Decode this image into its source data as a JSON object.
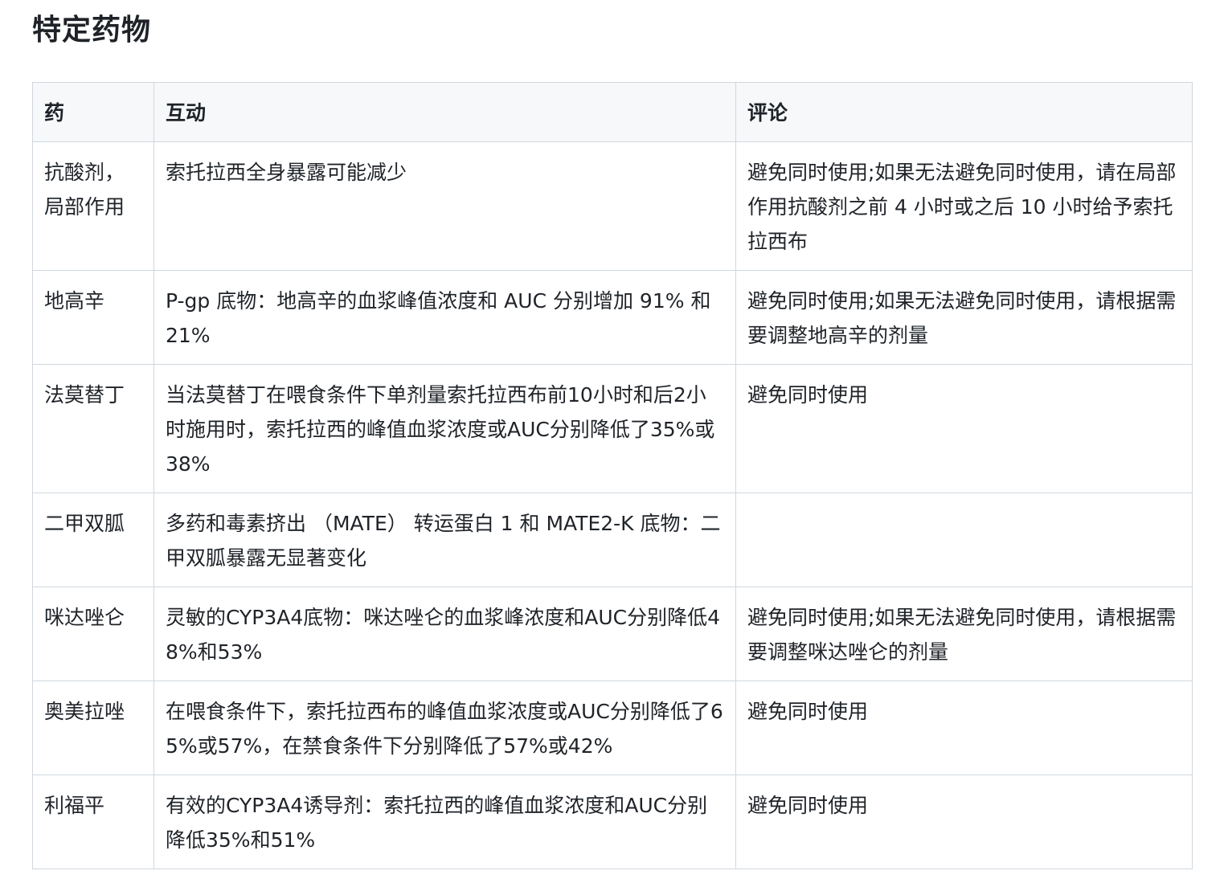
{
  "page_title": "特定药物",
  "table": {
    "headers": [
      "药",
      "互动",
      "评论"
    ],
    "rows": [
      [
        "抗酸剂，局部作用",
        "索托拉西全身暴露可能减少",
        "避免同时使用;如果无法避免同时使用，请在局部作用抗酸剂之前 4 小时或之后 10 小时给予索托拉西布"
      ],
      [
        "地高辛",
        "P-gp 底物：地高辛的血浆峰值浓度和 AUC 分别增加 91% 和 21%",
        "避免同时使用;如果无法避免同时使用，请根据需要调整地高辛的剂量"
      ],
      [
        "法莫替丁",
        "当法莫替丁在喂食条件下单剂量索托拉西布前10小时和后2小时施用时，索托拉西的峰值血浆浓度或AUC分别降低了35%或38%",
        "避免同时使用"
      ],
      [
        "二甲双胍",
        "多药和毒素挤出 （MATE） 转运蛋白 1 和 MATE2-K 底物：二甲双胍暴露无显著变化",
        ""
      ],
      [
        "咪达唑仑",
        "灵敏的CYP3A4底物：咪达唑仑的血浆峰浓度和AUC分别降低48%和53%",
        "避免同时使用;如果无法避免同时使用，请根据需要调整咪达唑仑的剂量"
      ],
      [
        "奥美拉唑",
        "在喂食条件下，索托拉西布的峰值血浆浓度或AUC分别降低了65%或57%，在禁食条件下分别降低了57%或42%",
        "避免同时使用"
      ],
      [
        "利福平",
        "有效的CYP3A4诱导剂：索托拉西的峰值血浆浓度和AUC分别降低35%和51%",
        "避免同时使用"
      ]
    ]
  },
  "colors": {
    "text": "#1f2328",
    "border": "#d0d7de",
    "header_bg": "#f6f8fa"
  }
}
